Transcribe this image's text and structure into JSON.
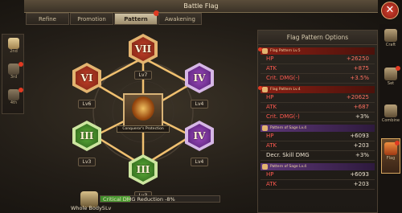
{
  "window": {
    "title": "Battle Flag",
    "close_glyph": "✕"
  },
  "tabs": [
    {
      "label": "Refine"
    },
    {
      "label": "Promotion"
    },
    {
      "label": "Pattern",
      "active": true
    },
    {
      "label": "Awakening"
    }
  ],
  "left_nav": [
    {
      "label": "2nd",
      "active": true
    },
    {
      "label": "3rd"
    },
    {
      "label": "4th"
    }
  ],
  "pattern": {
    "nodes": [
      {
        "numeral": "VII",
        "level": "Lv7",
        "color": "orange"
      },
      {
        "numeral": "VI",
        "level": "Lv6",
        "color": "orange"
      },
      {
        "numeral": "IV",
        "level": "Lv4",
        "color": "purple"
      },
      {
        "numeral": "III",
        "level": "Lv3",
        "color": "green"
      },
      {
        "numeral": "IV",
        "level": "Lv4",
        "color": "purple"
      },
      {
        "numeral": "III",
        "level": "Lv3",
        "color": "green"
      }
    ],
    "center_label": "Conqueror's Protection"
  },
  "bottom": {
    "whole_body_label": "Whole Body5Lv",
    "crit_text": "Critical DMG Reduction -8%",
    "crit_progress": 0.25
  },
  "panel": {
    "title": "Flag Pattern Options",
    "options": [
      {
        "header": "Flag Pattern Lv.5",
        "color": "red",
        "stats": [
          {
            "name": "HP",
            "value": "+26250"
          },
          {
            "name": "ATK",
            "value": "+875"
          },
          {
            "name": "Crit. DMG(-)",
            "value": "+3.5%"
          }
        ]
      },
      {
        "header": "Flag Pattern Lv.4",
        "color": "red",
        "stats": [
          {
            "name": "HP",
            "value": "+20625"
          },
          {
            "name": "ATK",
            "value": "+687"
          },
          {
            "name": "Crit. DMG(-)",
            "value": "+3%"
          }
        ]
      },
      {
        "header": "Pattern of Sage Lv.4",
        "color": "purple",
        "stats": [
          {
            "name": "HP",
            "value": "+6093"
          },
          {
            "name": "ATK",
            "value": "+203"
          },
          {
            "name": "Decr. Skill DMG",
            "value": "+3%"
          }
        ]
      },
      {
        "header": "Pattern of Sage Lv.4",
        "color": "purple",
        "stats": [
          {
            "name": "HP",
            "value": "+6093"
          },
          {
            "name": "ATK",
            "value": "+203"
          }
        ]
      }
    ]
  },
  "right_nav": [
    {
      "label": "Craft",
      "icon": "anvil-icon"
    },
    {
      "label": "Set",
      "icon": "armor-icon"
    },
    {
      "label": "Combine",
      "icon": "ring-icon"
    },
    {
      "label": "Flag",
      "icon": "flag-icon",
      "active": true
    }
  ]
}
